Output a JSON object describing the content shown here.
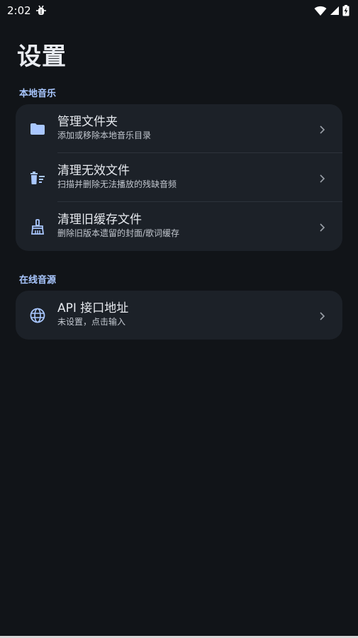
{
  "status_bar": {
    "time": "2:02",
    "notification_icon": "debug-bug-icon",
    "wifi_icon": "wifi-icon",
    "signal_icon": "signal-icon",
    "battery_icon": "battery-charging-icon"
  },
  "page": {
    "title": "设置"
  },
  "sections": [
    {
      "header": "本地音乐",
      "items": [
        {
          "icon": "folder-icon",
          "title": "管理文件夹",
          "subtitle": "添加或移除本地音乐目录"
        },
        {
          "icon": "delete-sweep-icon",
          "title": "清理无效文件",
          "subtitle": "扫描并删除无法播放的残缺音频"
        },
        {
          "icon": "cleaning-brush-icon",
          "title": "清理旧缓存文件",
          "subtitle": "删除旧版本遗留的封面/歌词缓存"
        }
      ]
    },
    {
      "header": "在线音源",
      "items": [
        {
          "icon": "globe-icon",
          "title": "API 接口地址",
          "subtitle": "未设置，点击输入"
        }
      ]
    }
  ],
  "colors": {
    "background": "#111418",
    "card": "#1c2128",
    "accent": "#a9c7ff",
    "title_text": "#e6e9ee",
    "subtitle_text": "#c2c7cf"
  }
}
